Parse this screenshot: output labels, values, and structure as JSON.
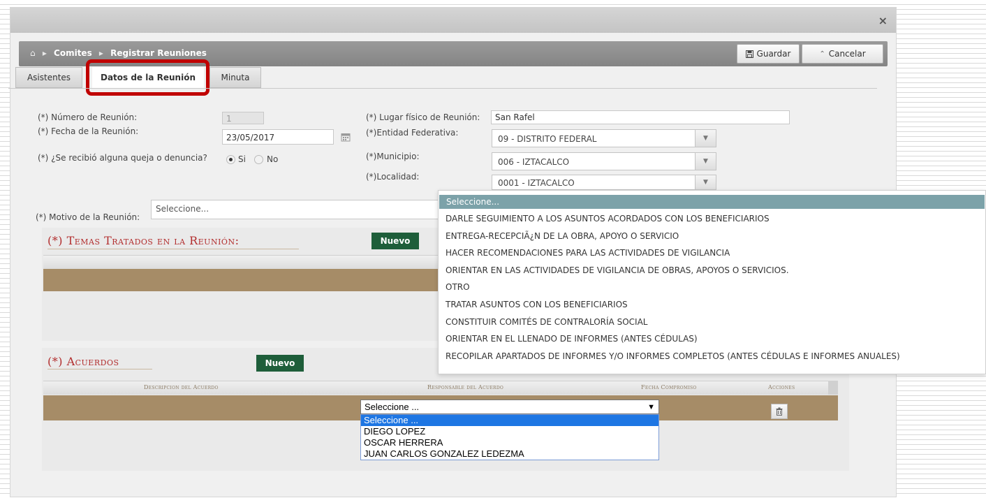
{
  "window": {
    "close_glyph": "×"
  },
  "breadcrumb": {
    "home_icon": "home-icon",
    "items": [
      "Comites",
      "Registrar Reuniones"
    ]
  },
  "toolbar": {
    "save_label": "Guardar",
    "save_icon": "floppy-icon",
    "cancel_label": "Cancelar",
    "cancel_icon": "chevron-up-icon"
  },
  "tabs": [
    {
      "label": "Asistentes"
    },
    {
      "label": "Datos de la Reunión",
      "active": true
    },
    {
      "label": "Minuta"
    }
  ],
  "form": {
    "numero_label": "(*) Número de Reunión:",
    "numero_value": "1",
    "fecha_label": "(*) Fecha de la Reunión:",
    "fecha_value": "23/05/2017",
    "queja_label": "(*) ¿Se recibió alguna queja o denuncia?",
    "queja_si": "Si",
    "queja_no": "No",
    "queja_selected": "Si",
    "lugar_label": "(*) Lugar físico de Reunión:",
    "lugar_value": "San Rafel",
    "entidad_label": "(*)Entidad Federativa:",
    "entidad_value": "09 - DISTRITO FEDERAL",
    "municipio_label": "(*)Municipio:",
    "municipio_value": "006 - IZTACALCO",
    "localidad_label": "(*)Localidad:",
    "localidad_value": "0001 - IZTACALCO",
    "motivo_label": "(*) Motivo de la Reunión:",
    "motivo_value": "Seleccione..."
  },
  "temas": {
    "title": "(*) Temas Tratados en la Reunión:",
    "new_label": "Nuevo"
  },
  "acuerdos": {
    "title": "(*) Acuerdos",
    "new_label": "Nuevo",
    "columns": [
      "Descripcion del Acuerdo",
      "Responsable del Acuerdo",
      "Fecha Compromiso",
      "Acciones"
    ],
    "responsable_value": "Seleccione ...",
    "responsable_options": [
      "Seleccione ...",
      "DIEGO LOPEZ",
      "OSCAR HERRERA",
      "JUAN CARLOS GONZALEZ LEDEZMA"
    ]
  },
  "motivo_options": [
    "Seleccione...",
    "DARLE SEGUIMIENTO A LOS ASUNTOS ACORDADOS CON LOS BENEFICIARIOS",
    "ENTREGA-RECEPCIÃ¿N DE LA OBRA, APOYO O SERVICIO",
    "HACER RECOMENDACIONES PARA LAS ACTIVIDADES DE VIGILANCIA",
    "ORIENTAR EN LAS ACTIVIDADES DE VIGILANCIA DE OBRAS, APOYOS O SERVICIOS.",
    "OTRO",
    "TRATAR ASUNTOS CON LOS BENEFICIARIOS",
    "CONSTITUIR COMITÉS DE CONTRALORÍA SOCIAL",
    "ORIENTAR EN EL LLENADO DE INFORMES (ANTES CÉDULAS)",
    "RECOPILAR APARTADOS DE INFORMES Y/O INFORMES COMPLETOS (ANTES CÉDULAS E INFORMES ANUALES)"
  ],
  "colors": {
    "highlight_frame": "#c00000",
    "section_title": "#b22d2d",
    "nuevo_button": "#1e5e3a",
    "table_row": "#a68c67",
    "list_highlight": "#7ca2a9",
    "native_select_highlight": "#1e76e3"
  }
}
